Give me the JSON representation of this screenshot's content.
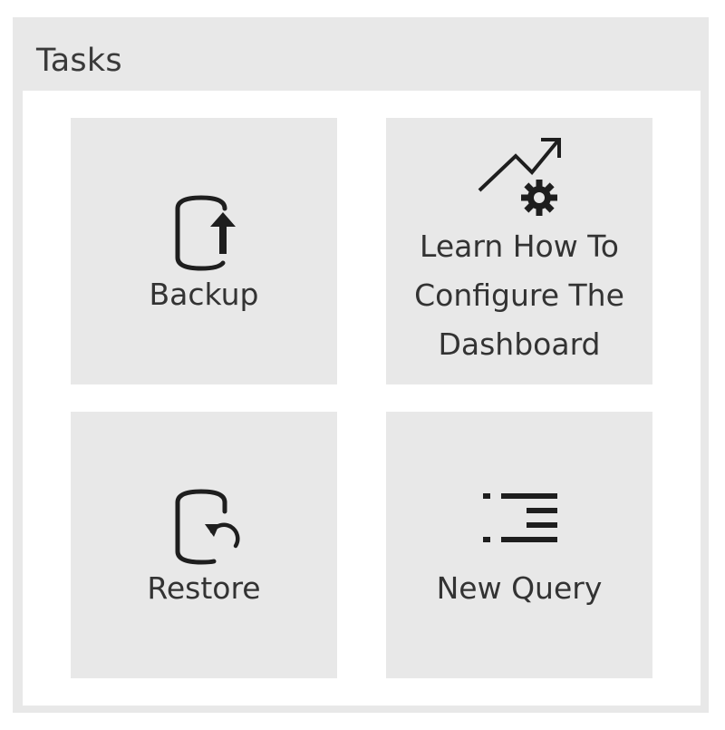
{
  "widget": {
    "title": "Tasks"
  },
  "tasks": [
    {
      "label": "Backup",
      "icon": "backup-icon"
    },
    {
      "label": "Learn How To Configure The Dashboard",
      "label_lines": [
        "Learn How To",
        "Configure The",
        "Dashboard"
      ],
      "icon": "trend-gear-icon"
    },
    {
      "label": "Restore",
      "icon": "restore-icon"
    },
    {
      "label": "New Query",
      "icon": "new-query-icon"
    }
  ],
  "colors": {
    "panel_background": "#e8e8e8",
    "body_background": "#ffffff",
    "text": "#333333",
    "icon": "#1e1e1e"
  }
}
